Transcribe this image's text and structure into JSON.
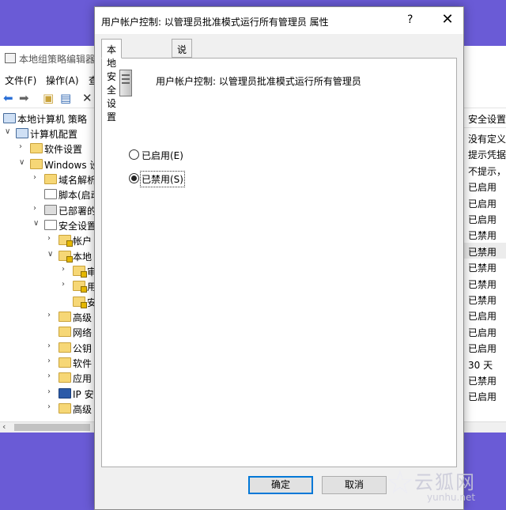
{
  "background_window": {
    "title": "本地组策略编辑器",
    "menu": [
      "文件(F)",
      "操作(A)",
      "查"
    ],
    "tree": [
      {
        "label": "本地计算机 策略",
        "icon": "computer-icon"
      },
      {
        "label": "计算机配置",
        "icon": "computer-icon"
      },
      {
        "label": "软件设置",
        "icon": "folder-icon"
      },
      {
        "label": "Windows 设",
        "icon": "folder-icon"
      },
      {
        "label": "域名解析",
        "icon": "folder-icon"
      },
      {
        "label": "脚本(启动",
        "icon": "document-icon"
      },
      {
        "label": "已部署的",
        "icon": "printer-icon"
      },
      {
        "label": "安全设置",
        "icon": "security-icon"
      },
      {
        "label": "帐户",
        "icon": "folder-lock-icon"
      },
      {
        "label": "本地",
        "icon": "folder-lock-icon"
      },
      {
        "label": "审",
        "icon": "folder-lock-icon"
      },
      {
        "label": "用",
        "icon": "folder-lock-icon"
      },
      {
        "label": "安",
        "icon": "folder-lock-icon"
      },
      {
        "label": "高级",
        "icon": "folder-icon"
      },
      {
        "label": "网络",
        "icon": "folder-icon"
      },
      {
        "label": "公钥",
        "icon": "folder-icon"
      },
      {
        "label": "软件",
        "icon": "folder-icon"
      },
      {
        "label": "应用",
        "icon": "folder-icon"
      },
      {
        "label": "IP 安",
        "icon": "shield-icon"
      },
      {
        "label": "高级",
        "icon": "folder-icon"
      }
    ],
    "right_column": {
      "header": "安全设置",
      "rows": [
        "没有定义",
        "提示凭据",
        "不提示，直",
        "已启用",
        "已启用",
        "已启用",
        "已禁用",
        "已禁用",
        "已禁用",
        "已禁用",
        "已禁用",
        "已启用",
        "已启用",
        "已启用",
        "30 天",
        "已禁用",
        "已启用"
      ]
    }
  },
  "dialog": {
    "title": "用户帐户控制: 以管理员批准模式运行所有管理员 属性",
    "help_label": "?",
    "close_label": "✕",
    "tabs": [
      "本地安全设置",
      "说明"
    ],
    "policy_name": "用户帐户控制: 以管理员批准模式运行所有管理员",
    "options": [
      {
        "label": "已启用(E)",
        "checked": false
      },
      {
        "label": "已禁用(S)",
        "checked": true
      }
    ],
    "ok_label": "确定",
    "cancel_label": "取消"
  },
  "watermark": {
    "text": "云狐网",
    "url_text": "yunhu.net"
  }
}
